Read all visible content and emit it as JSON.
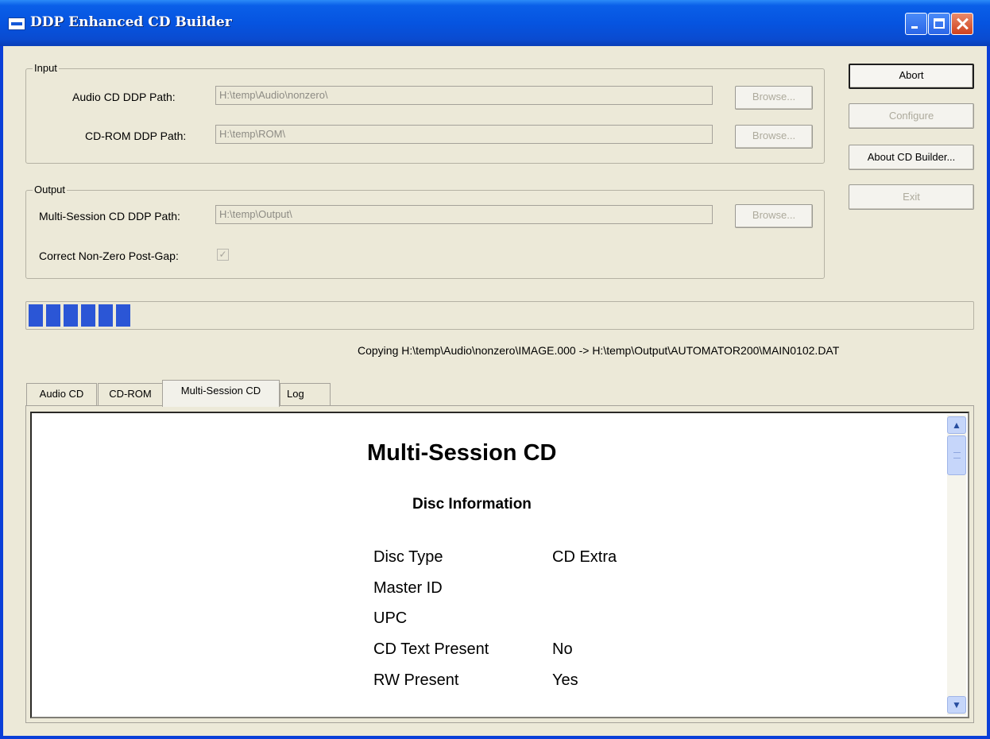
{
  "window": {
    "title": "DDP Enhanced CD Builder"
  },
  "input": {
    "group_label": "Input",
    "audio_label": "Audio CD DDP Path:",
    "audio_value": "H:\\temp\\Audio\\nonzero\\",
    "rom_label": "CD-ROM DDP Path:",
    "rom_value": "H:\\temp\\ROM\\",
    "browse_label": "Browse..."
  },
  "output": {
    "group_label": "Output",
    "multi_label": "Multi-Session CD DDP Path:",
    "multi_value": "H:\\temp\\Output\\",
    "browse_label": "Browse...",
    "postgap_label": "Correct Non-Zero Post-Gap:",
    "postgap_checked": true
  },
  "buttons": {
    "abort": "Abort",
    "configure": "Configure",
    "about": "About CD Builder...",
    "exit": "Exit"
  },
  "progress": {
    "blocks_filled": 6
  },
  "status": "Copying H:\\temp\\Audio\\nonzero\\IMAGE.000 -> H:\\temp\\Output\\AUTOMATOR200\\MAIN0102.DAT",
  "tabs": [
    "Audio CD",
    "CD-ROM",
    "Multi-Session CD",
    "Log"
  ],
  "active_tab": 2,
  "report": {
    "title": "Multi-Session CD",
    "section": "Disc Information",
    "rows": [
      {
        "key": "Disc Type",
        "value": "CD Extra"
      },
      {
        "key": "Master ID",
        "value": ""
      },
      {
        "key": "UPC",
        "value": ""
      },
      {
        "key": "CD Text Present",
        "value": "No"
      },
      {
        "key": "RW Present",
        "value": "Yes"
      }
    ]
  },
  "colors": {
    "titlebar": "#0654E0",
    "progress": "#2B56D6",
    "dialog_bg": "#ECE9D8"
  },
  "icons": {
    "scroll_up": "scroll-up-arrow-icon",
    "scroll_down": "scroll-down-arrow-icon"
  }
}
